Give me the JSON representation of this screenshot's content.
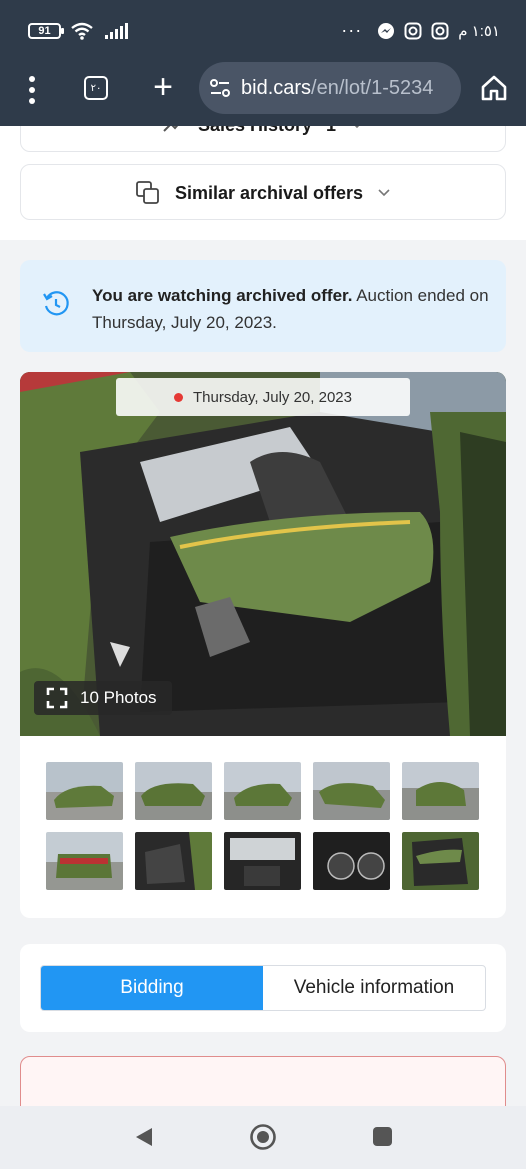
{
  "status_bar": {
    "battery": "91",
    "time": "١:٥١ م",
    "overflow": "···"
  },
  "browser": {
    "tab_count": "٢٠",
    "url_host": "bid.cars",
    "url_path": "/en/lot/1-5234"
  },
  "page": {
    "sales_history_label": "Sales History",
    "sales_history_count": "1",
    "similar_offers_label": "Similar archival offers",
    "notice_bold": "You are watching archived offer.",
    "notice_rest": " Auction ended on Thursday, July 20, 2023.",
    "photo_date": "Thursday, July 20, 2023",
    "photos_count_label": "10 Photos",
    "tabs": [
      "Bidding",
      "Vehicle information"
    ]
  },
  "colors": {
    "accent": "#2196f3",
    "notice_bg": "#e3f1fc",
    "car_green": "#5f7a3a"
  }
}
